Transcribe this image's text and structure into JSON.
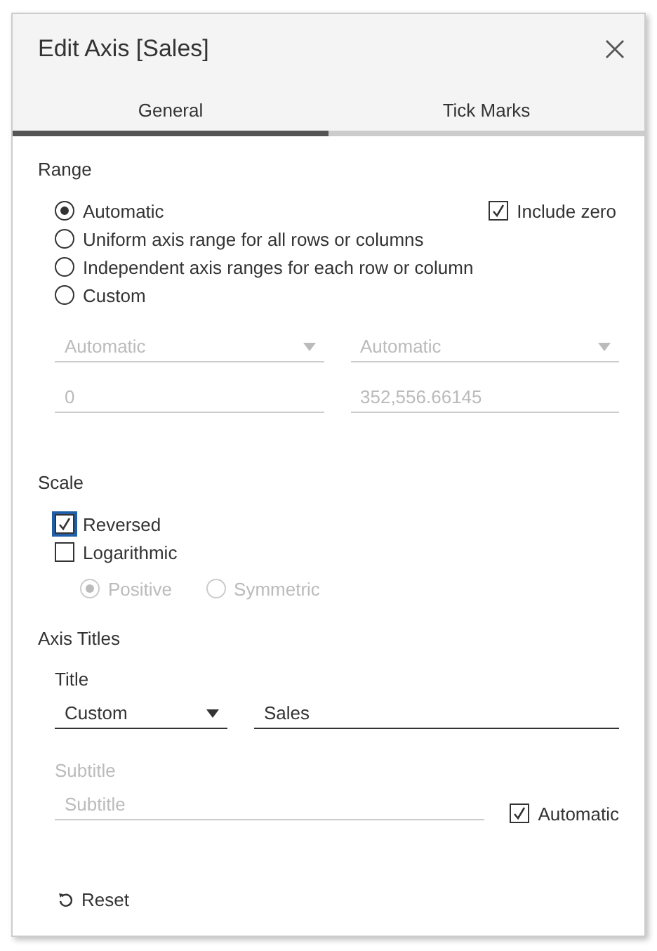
{
  "dialog": {
    "title": "Edit Axis [Sales]"
  },
  "tabs": [
    {
      "label": "General",
      "selected": true
    },
    {
      "label": "Tick Marks",
      "selected": false
    }
  ],
  "range": {
    "heading": "Range",
    "options": [
      {
        "label": "Automatic",
        "selected": true
      },
      {
        "label": "Uniform axis range for all rows or columns",
        "selected": false
      },
      {
        "label": "Independent axis ranges for each row or column",
        "selected": false
      },
      {
        "label": "Custom",
        "selected": false
      }
    ],
    "include_zero": {
      "label": "Include zero",
      "checked": true
    },
    "dropdowns": [
      {
        "value": "Automatic",
        "disabled": true
      },
      {
        "value": "Automatic",
        "disabled": true
      }
    ],
    "fields": [
      {
        "value": "0",
        "disabled": true
      },
      {
        "value": "352,556.66145",
        "disabled": true
      }
    ]
  },
  "scale": {
    "heading": "Scale",
    "options": [
      {
        "label": "Reversed",
        "checked": true,
        "focused": true
      },
      {
        "label": "Logarithmic",
        "checked": false,
        "focused": false
      }
    ],
    "log_modes": [
      {
        "label": "Positive",
        "selected": true,
        "disabled": true
      },
      {
        "label": "Symmetric",
        "selected": false,
        "disabled": true
      }
    ]
  },
  "axis_titles": {
    "heading": "Axis Titles",
    "title": {
      "label": "Title",
      "mode": "Custom",
      "value": "Sales"
    },
    "subtitle": {
      "label": "Subtitle",
      "placeholder": "Subtitle",
      "disabled": true,
      "automatic": {
        "label": "Automatic",
        "checked": true
      }
    }
  },
  "reset": {
    "label": "Reset"
  }
}
